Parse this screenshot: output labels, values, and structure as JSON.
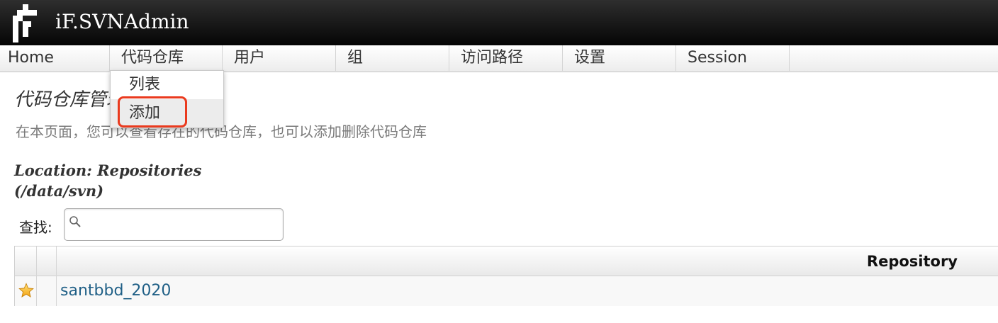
{
  "app": {
    "title": "iF.SVNAdmin"
  },
  "nav": {
    "items": [
      {
        "label": "Home"
      },
      {
        "label": "代码仓库"
      },
      {
        "label": "用户"
      },
      {
        "label": "组"
      },
      {
        "label": "访问路径"
      },
      {
        "label": "设置"
      },
      {
        "label": "Session"
      }
    ]
  },
  "dropdown": {
    "items": [
      {
        "label": "列表"
      },
      {
        "label": "添加"
      }
    ],
    "highlighted_item": "添加",
    "highlight_color": "#ea3a1e"
  },
  "page": {
    "title": "代码仓库管理",
    "description": "在本页面，您可以查看存在的代码仓库，也可以添加删除代码仓库",
    "location_line1": "Location: Repositories",
    "location_line2": "(/data/svn)"
  },
  "search": {
    "label": "查找:",
    "value": "",
    "icon": "search-icon"
  },
  "table": {
    "columns": [
      "Repository"
    ],
    "rows": [
      {
        "name": "santbbd_2020",
        "icon": "star-icon"
      }
    ]
  },
  "colors": {
    "link": "#1f5f86",
    "header_bg": "#111111"
  }
}
